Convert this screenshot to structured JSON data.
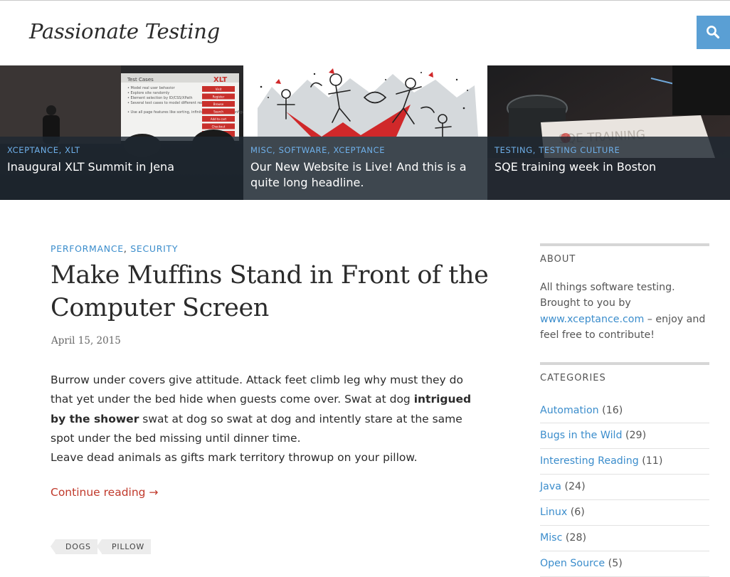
{
  "site": {
    "title": "Passionate Testing"
  },
  "header": {
    "search_icon": "search-icon",
    "accent_color": "#5a9fd4"
  },
  "featured": [
    {
      "categories": [
        "Xceptance",
        "XLT"
      ],
      "title": "Inaugural XLT Summit in Jena",
      "slide": {
        "heading": "Test Cases",
        "logo": "XLT",
        "bullets": [
          "Model real user behavior",
          "Explore site randomly",
          "Element selection by ID/CSS/XPath",
          "Several test cases to model different real user types",
          "Use all page features like sorting, infinite scroll, product configuration"
        ],
        "buttons": [
          "Visit",
          "Register",
          "Browse",
          "Search",
          "Add to cart",
          "Checkout",
          "Order"
        ]
      }
    },
    {
      "categories": [
        "Misc",
        "Software",
        "Xceptance"
      ],
      "title": "Our New Website is Live! And this is a quite long headline."
    },
    {
      "categories": [
        "Testing",
        "Testing Culture"
      ],
      "title": "SQE training week in Boston",
      "sign_text": "SQE TRAINING"
    }
  ],
  "post": {
    "categories": [
      "Performance",
      "Security"
    ],
    "title": "Make Muffins Stand in Front of the Computer Screen",
    "date": "April 15, 2015",
    "p1_a": "Burrow under covers give attitude. Attack feet climb leg why must they do that yet under the bed hide when guests come over. Swat at dog ",
    "p1_bold": "intrigued by the shower",
    "p1_b": " swat at dog so swat at dog and intently stare at the same spot under the bed missing until dinner time.",
    "p2": "Leave dead animals as gifts mark territory throwup on your pillow.",
    "continue_label": "Continue reading →",
    "tags": [
      "Dogs",
      "Pillow"
    ]
  },
  "sidebar": {
    "about": {
      "title": "About",
      "text_before": "All things software testing. Brought to you by ",
      "link": "www.xceptance.com",
      "text_after": " – en­joy and feel free to contribute!"
    },
    "categories": {
      "title": "Categories",
      "items": [
        {
          "label": "Automation",
          "count": "(16)"
        },
        {
          "label": "Bugs in the Wild",
          "count": "(29)"
        },
        {
          "label": "Interesting Reading",
          "count": "(11)"
        },
        {
          "label": "Java",
          "count": "(24)"
        },
        {
          "label": "Linux",
          "count": "(6)"
        },
        {
          "label": "Misc",
          "count": "(28)"
        },
        {
          "label": "Open Source",
          "count": "(5)"
        }
      ]
    }
  },
  "colors": {
    "link": "#3b8dcc",
    "continue": "#c0392b",
    "featured_category": "#6fb0ea"
  }
}
